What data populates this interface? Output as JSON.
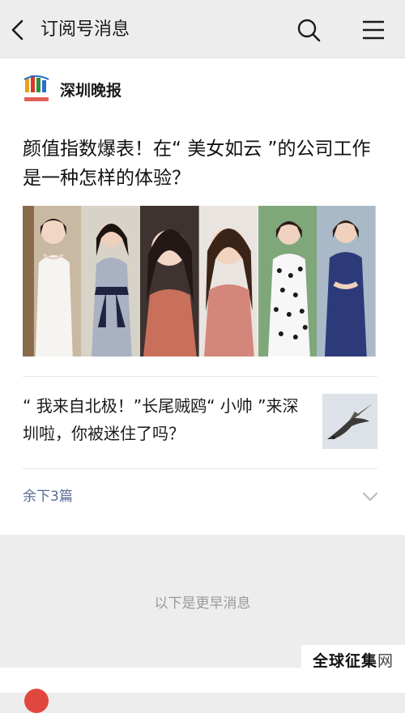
{
  "nav": {
    "title": "订阅号消息",
    "icons": [
      "back-arrow-icon",
      "search-icon",
      "menu-icon"
    ]
  },
  "account": {
    "name": "深圳晚报"
  },
  "main_article": {
    "title": "颜值指数爆表！在“ 美女如云 ”的公司工作是一种怎样的体验？"
  },
  "sub_article": {
    "title": "“ 我来自北极！”长尾贼鸥“ 小帅 ”来深圳啦，你被迷住了吗？"
  },
  "more": {
    "label": "余下3篇"
  },
  "earlier_label": "以下是更早消息",
  "watermark": {
    "bold": "全球征集",
    "light": "网"
  },
  "colors": {
    "background": "#ededed",
    "link": "#576b95",
    "muted": "#9a9a9a"
  }
}
